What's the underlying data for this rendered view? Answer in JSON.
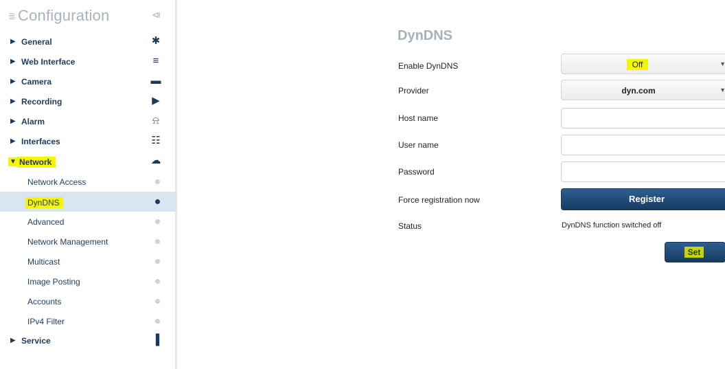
{
  "sidebar": {
    "title": "Configuration",
    "title_icon": "≣",
    "collapse_icon": "⧏",
    "nav_top": [
      {
        "label": "General",
        "icon": "✱"
      },
      {
        "label": "Web Interface",
        "icon": "≡"
      },
      {
        "label": "Camera",
        "icon": "▬"
      },
      {
        "label": "Recording",
        "icon": "▶"
      },
      {
        "label": "Alarm",
        "icon": "⍾"
      },
      {
        "label": "Interfaces",
        "icon": "☷"
      }
    ],
    "network": {
      "label": "Network",
      "icon": "☁"
    },
    "network_items": [
      "Network Access",
      "DynDNS",
      "Advanced",
      "Network Management",
      "Multicast",
      "Image Posting",
      "Accounts",
      "IPv4 Filter"
    ],
    "service": {
      "label": "Service",
      "icon": "▐"
    },
    "arrow_collapsed": "▶",
    "arrow_expanded": "▼"
  },
  "main": {
    "title": "DynDNS",
    "enable_label": "Enable DynDNS",
    "enable_value": "Off",
    "provider_label": "Provider",
    "provider_value": "dyn.com",
    "hostname_label": "Host name",
    "username_label": "User name",
    "password_label": "Password",
    "force_label": "Force registration now",
    "register_label": "Register",
    "status_label": "Status",
    "status_value": "DynDNS function switched off",
    "set_label": "Set",
    "caret": "▼"
  },
  "colors": {
    "highlight": "#f5f500",
    "nav_text": "#1d3a5e",
    "active_row": "#d9e6f2",
    "button": "#1d4570"
  }
}
